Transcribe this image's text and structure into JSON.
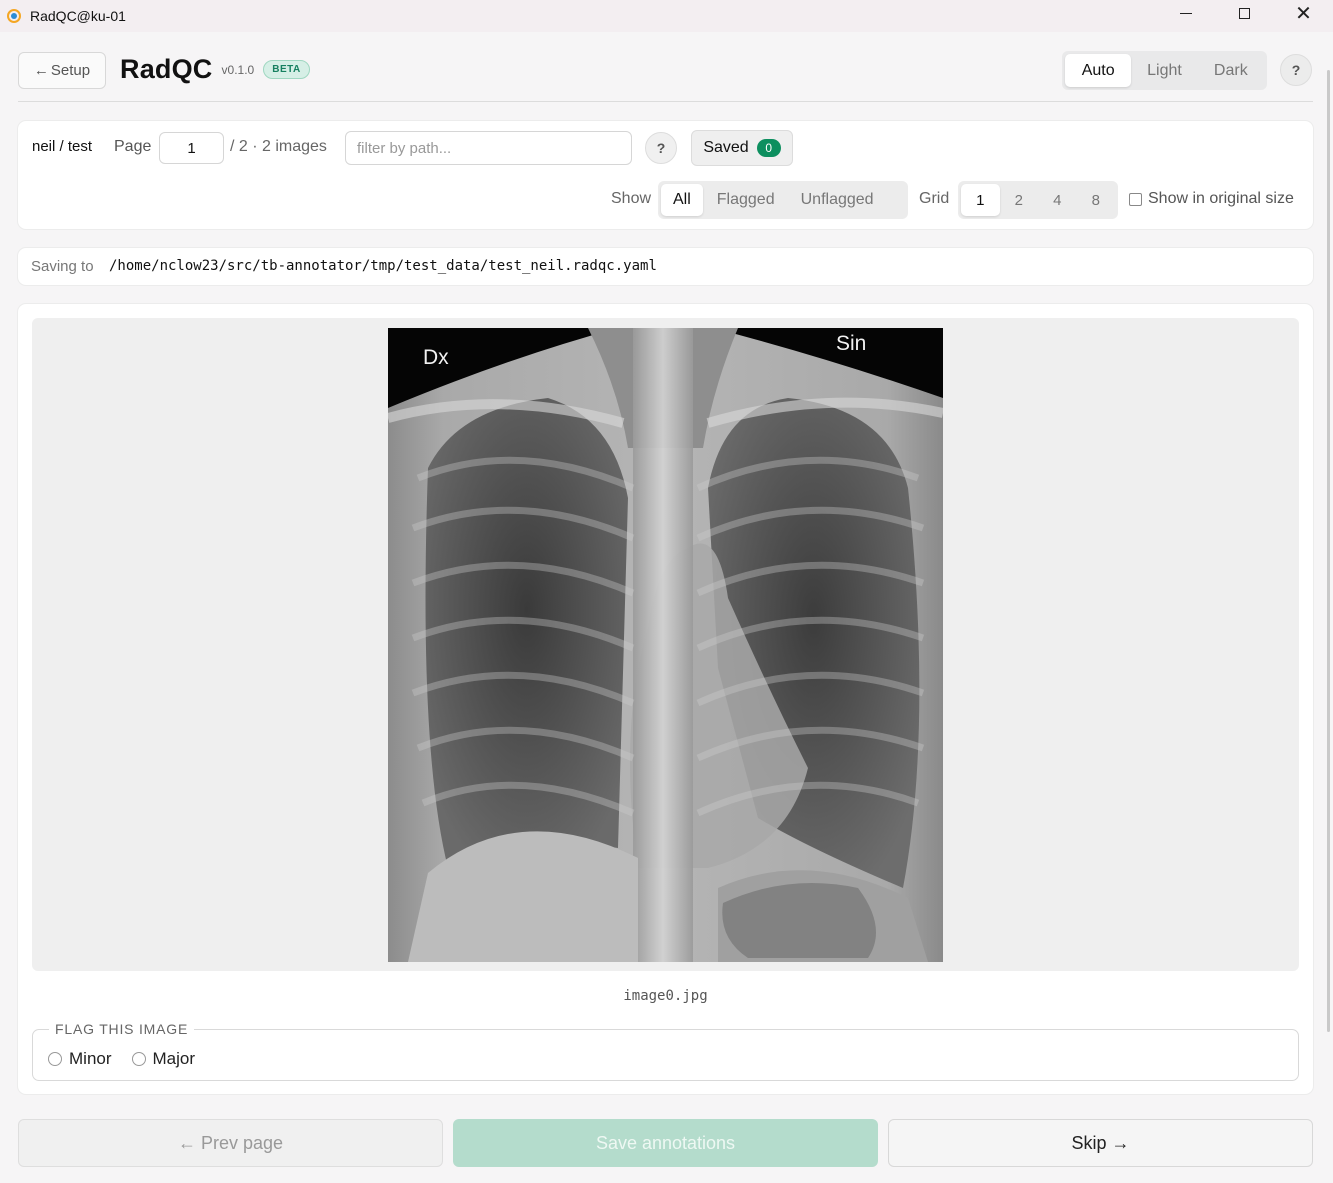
{
  "window": {
    "title": "RadQC@ku-01",
    "minimize_icon": "minimize-icon",
    "maximize_icon": "maximize-icon",
    "close_glyph": "✕"
  },
  "header": {
    "setup_arrow": "←",
    "setup_label": "Setup",
    "brand": "RadQC",
    "version": "v0.1.0",
    "beta": "BETA",
    "theme_options": [
      "Auto",
      "Light",
      "Dark"
    ],
    "theme_selected": "Auto",
    "help": "?"
  },
  "toolbar": {
    "crumb": "neil / test",
    "page_label": "Page",
    "page_value": "1",
    "page_total": "/ 2 · 2 images",
    "filter_placeholder": "filter by path...",
    "filter_help": "?",
    "saved_label": "Saved",
    "saved_count": "0",
    "show_label": "Show",
    "show_options": [
      "All",
      "Flagged",
      "Unflagged"
    ],
    "show_selected": "All",
    "grid_label": "Grid",
    "grid_options": [
      "1",
      "2",
      "4",
      "8"
    ],
    "grid_selected": "1",
    "original_size_label": "Show in original size"
  },
  "savebar": {
    "label": "Saving to",
    "path": "/home/nclow23/src/tb-annotator/tmp/test_data/test_neil.radqc.yaml"
  },
  "viewer": {
    "image_left_marker": "Dx",
    "image_right_marker": "Sin",
    "filename": "image0.jpg"
  },
  "flag": {
    "legend": "FLAG THIS IMAGE",
    "options": [
      "Minor",
      "Major"
    ]
  },
  "footer": {
    "prev_label": "← Prev page",
    "save_label": "Save annotations",
    "skip_label": "Skip →"
  },
  "colors": {
    "accent_green": "#0d8f5f",
    "save_button_disabled": "#b4dccc",
    "beta_badge_bg": "#d6efe6"
  }
}
